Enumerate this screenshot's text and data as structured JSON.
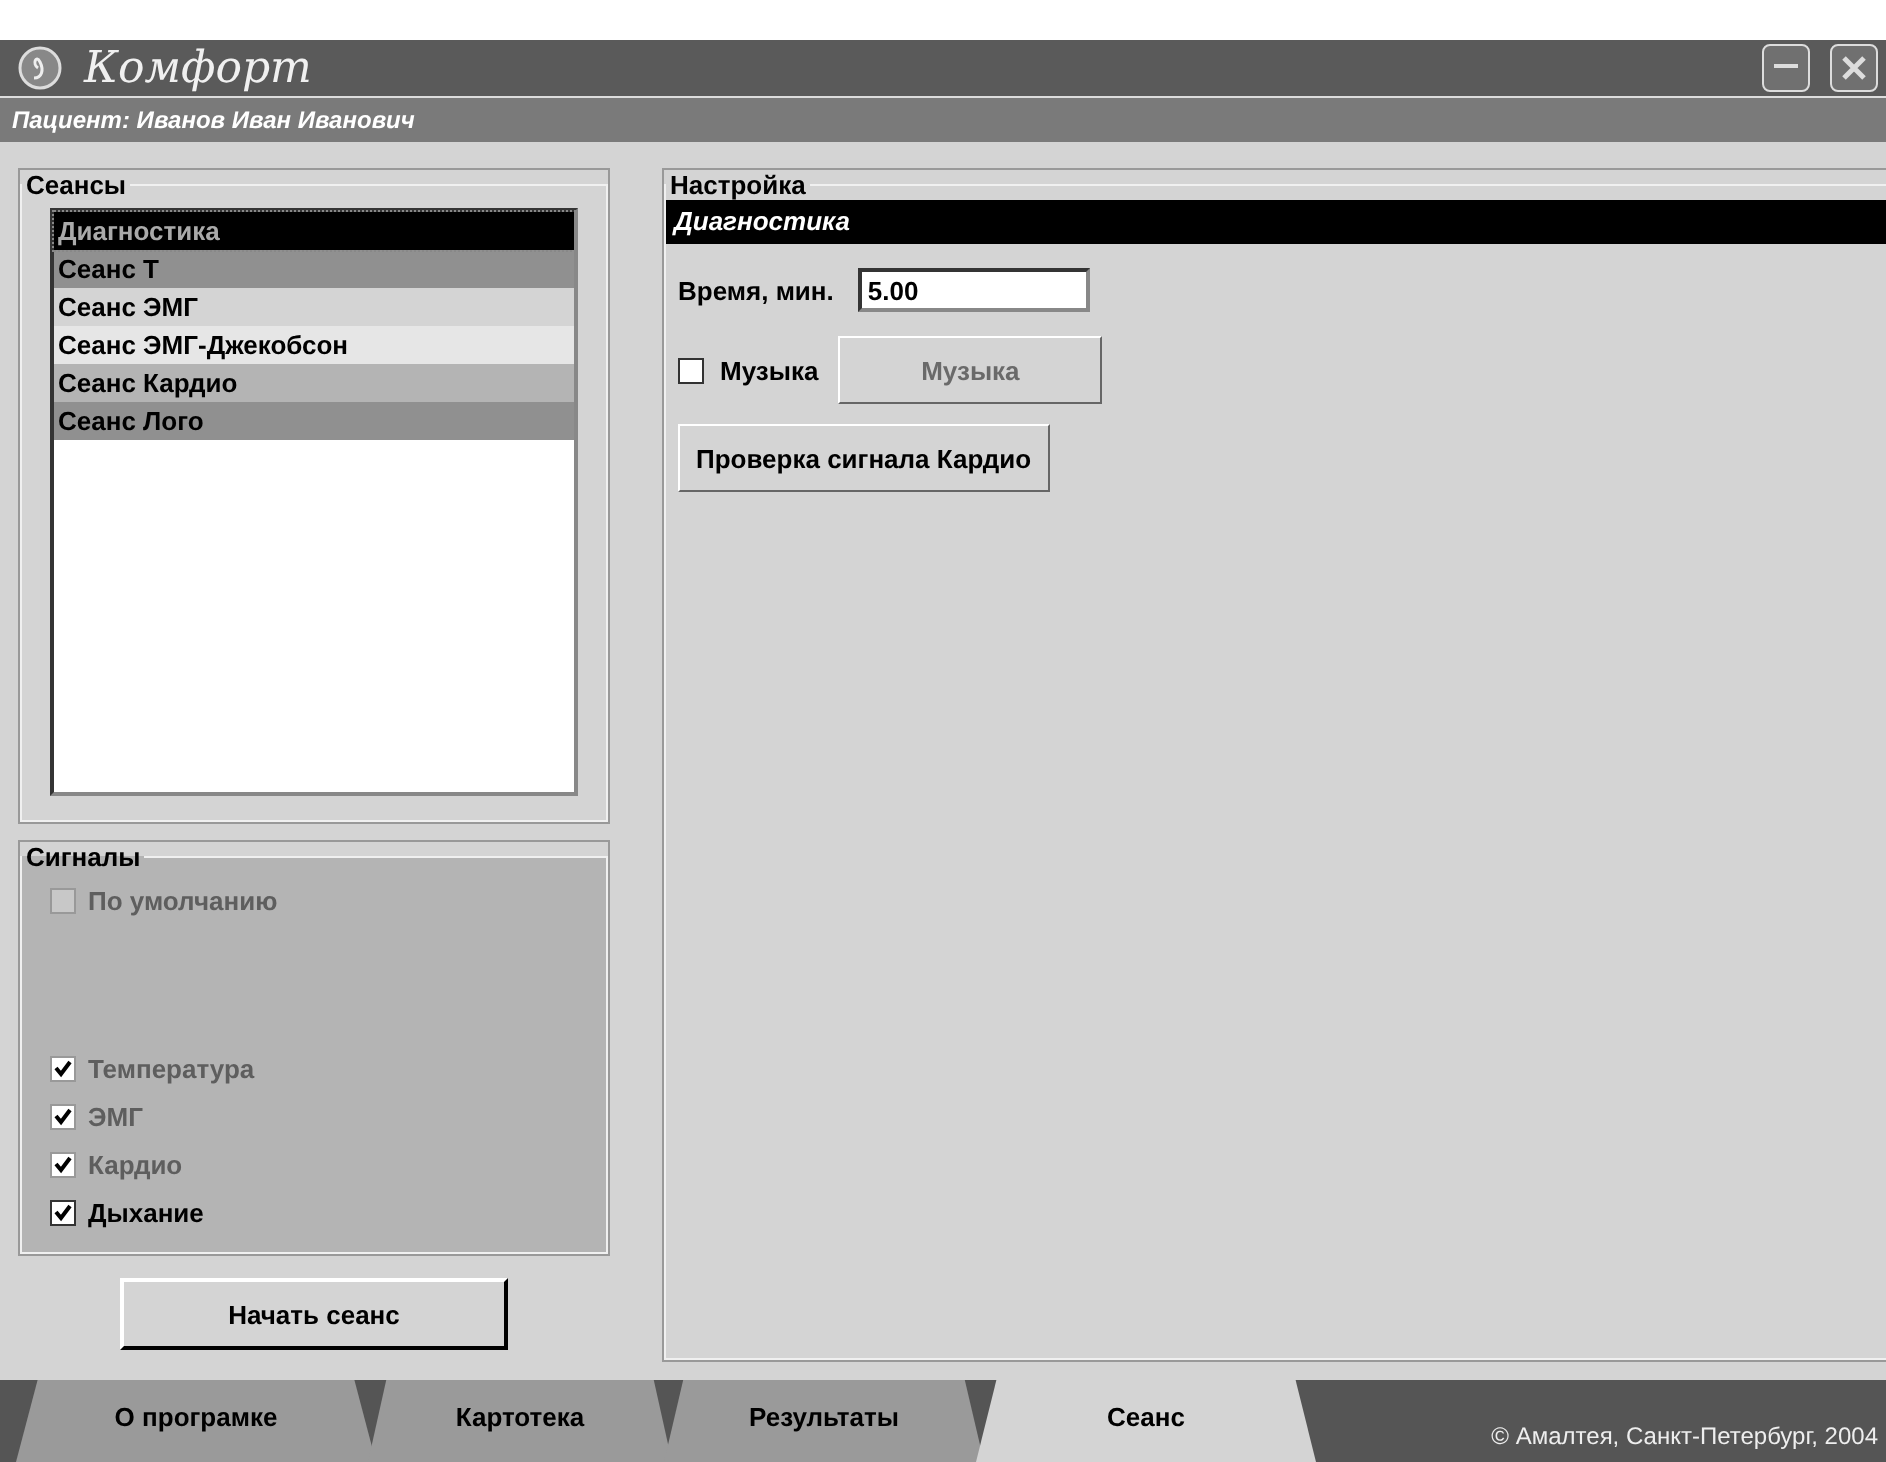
{
  "window": {
    "title": "Комфорт"
  },
  "patient": "Пациент: Иванов Иван Иванович",
  "sessions": {
    "title": "Сеансы",
    "items": [
      {
        "label": "Диагностика",
        "selected": true,
        "color": "#000000"
      },
      {
        "label": "Сеанс Т",
        "selected": false,
        "color": "#909090"
      },
      {
        "label": "Сеанс ЭМГ",
        "selected": false,
        "color": "#d4d4d4"
      },
      {
        "label": "Сеанс ЭМГ-Джекобсон",
        "selected": false,
        "color": "#e6e6e6"
      },
      {
        "label": "Сеанс Кардио",
        "selected": false,
        "color": "#b4b4b4"
      },
      {
        "label": "Сеанс Лого",
        "selected": false,
        "color": "#909090"
      }
    ]
  },
  "signals": {
    "title": "Сигналы",
    "items": [
      {
        "label": "По умолчанию",
        "checked": false,
        "disabled": true
      },
      {
        "label": "Температура",
        "checked": true,
        "disabled": true
      },
      {
        "label": "ЭМГ",
        "checked": true,
        "disabled": true
      },
      {
        "label": "Кардио",
        "checked": true,
        "disabled": true
      },
      {
        "label": "Дыхание",
        "checked": true,
        "disabled": false
      }
    ]
  },
  "start_button": "Начать сеанс",
  "settings": {
    "title": "Настройка",
    "session_name": "Диагностика",
    "time_label": "Время, мин.",
    "time_value": "5.00",
    "music": {
      "label": "Музыка",
      "checked": false
    },
    "music_button": {
      "label": "Музыка",
      "disabled": true
    },
    "check_button": "Проверка сигнала Кардио"
  },
  "tabs": [
    {
      "label": "О програмке",
      "selected": false
    },
    {
      "label": "Картотека",
      "selected": false
    },
    {
      "label": "Результаты",
      "selected": false
    },
    {
      "label": "Сеанс",
      "selected": true
    }
  ],
  "copyright": "© Амалтея, Санкт-Петербург, 2004"
}
